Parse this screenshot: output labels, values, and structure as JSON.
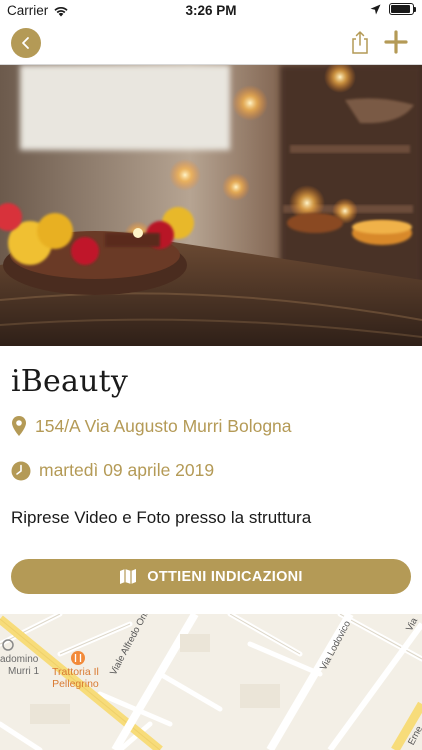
{
  "status_bar": {
    "carrier": "Carrier",
    "time": "3:26 PM",
    "battery_level": 0.9
  },
  "nav": {
    "back_icon": "chevron-left-icon",
    "share_icon": "share-icon",
    "add_icon": "plus-icon"
  },
  "event": {
    "title": "iBeauty",
    "address": "154/A Via Augusto Murri Bologna",
    "date": "martedì 09 aprile 2019",
    "description": "Riprese Video e Foto presso la struttura"
  },
  "directions_button": {
    "label": "OTTIENI INDICAZIONI",
    "icon": "map-icon"
  },
  "map": {
    "poi_label_1": "Trattoria Il",
    "poi_label_2": "Pellegrino",
    "poi_left_1": "adomino",
    "poi_left_2": "Murri 1",
    "street_1": "Viale Alfredo Oriani",
    "street_2": "Via Lodovico",
    "street_3": "Via",
    "street_4": "Erne"
  },
  "colors": {
    "accent": "#b49a56",
    "text": "#1a1a1a"
  }
}
